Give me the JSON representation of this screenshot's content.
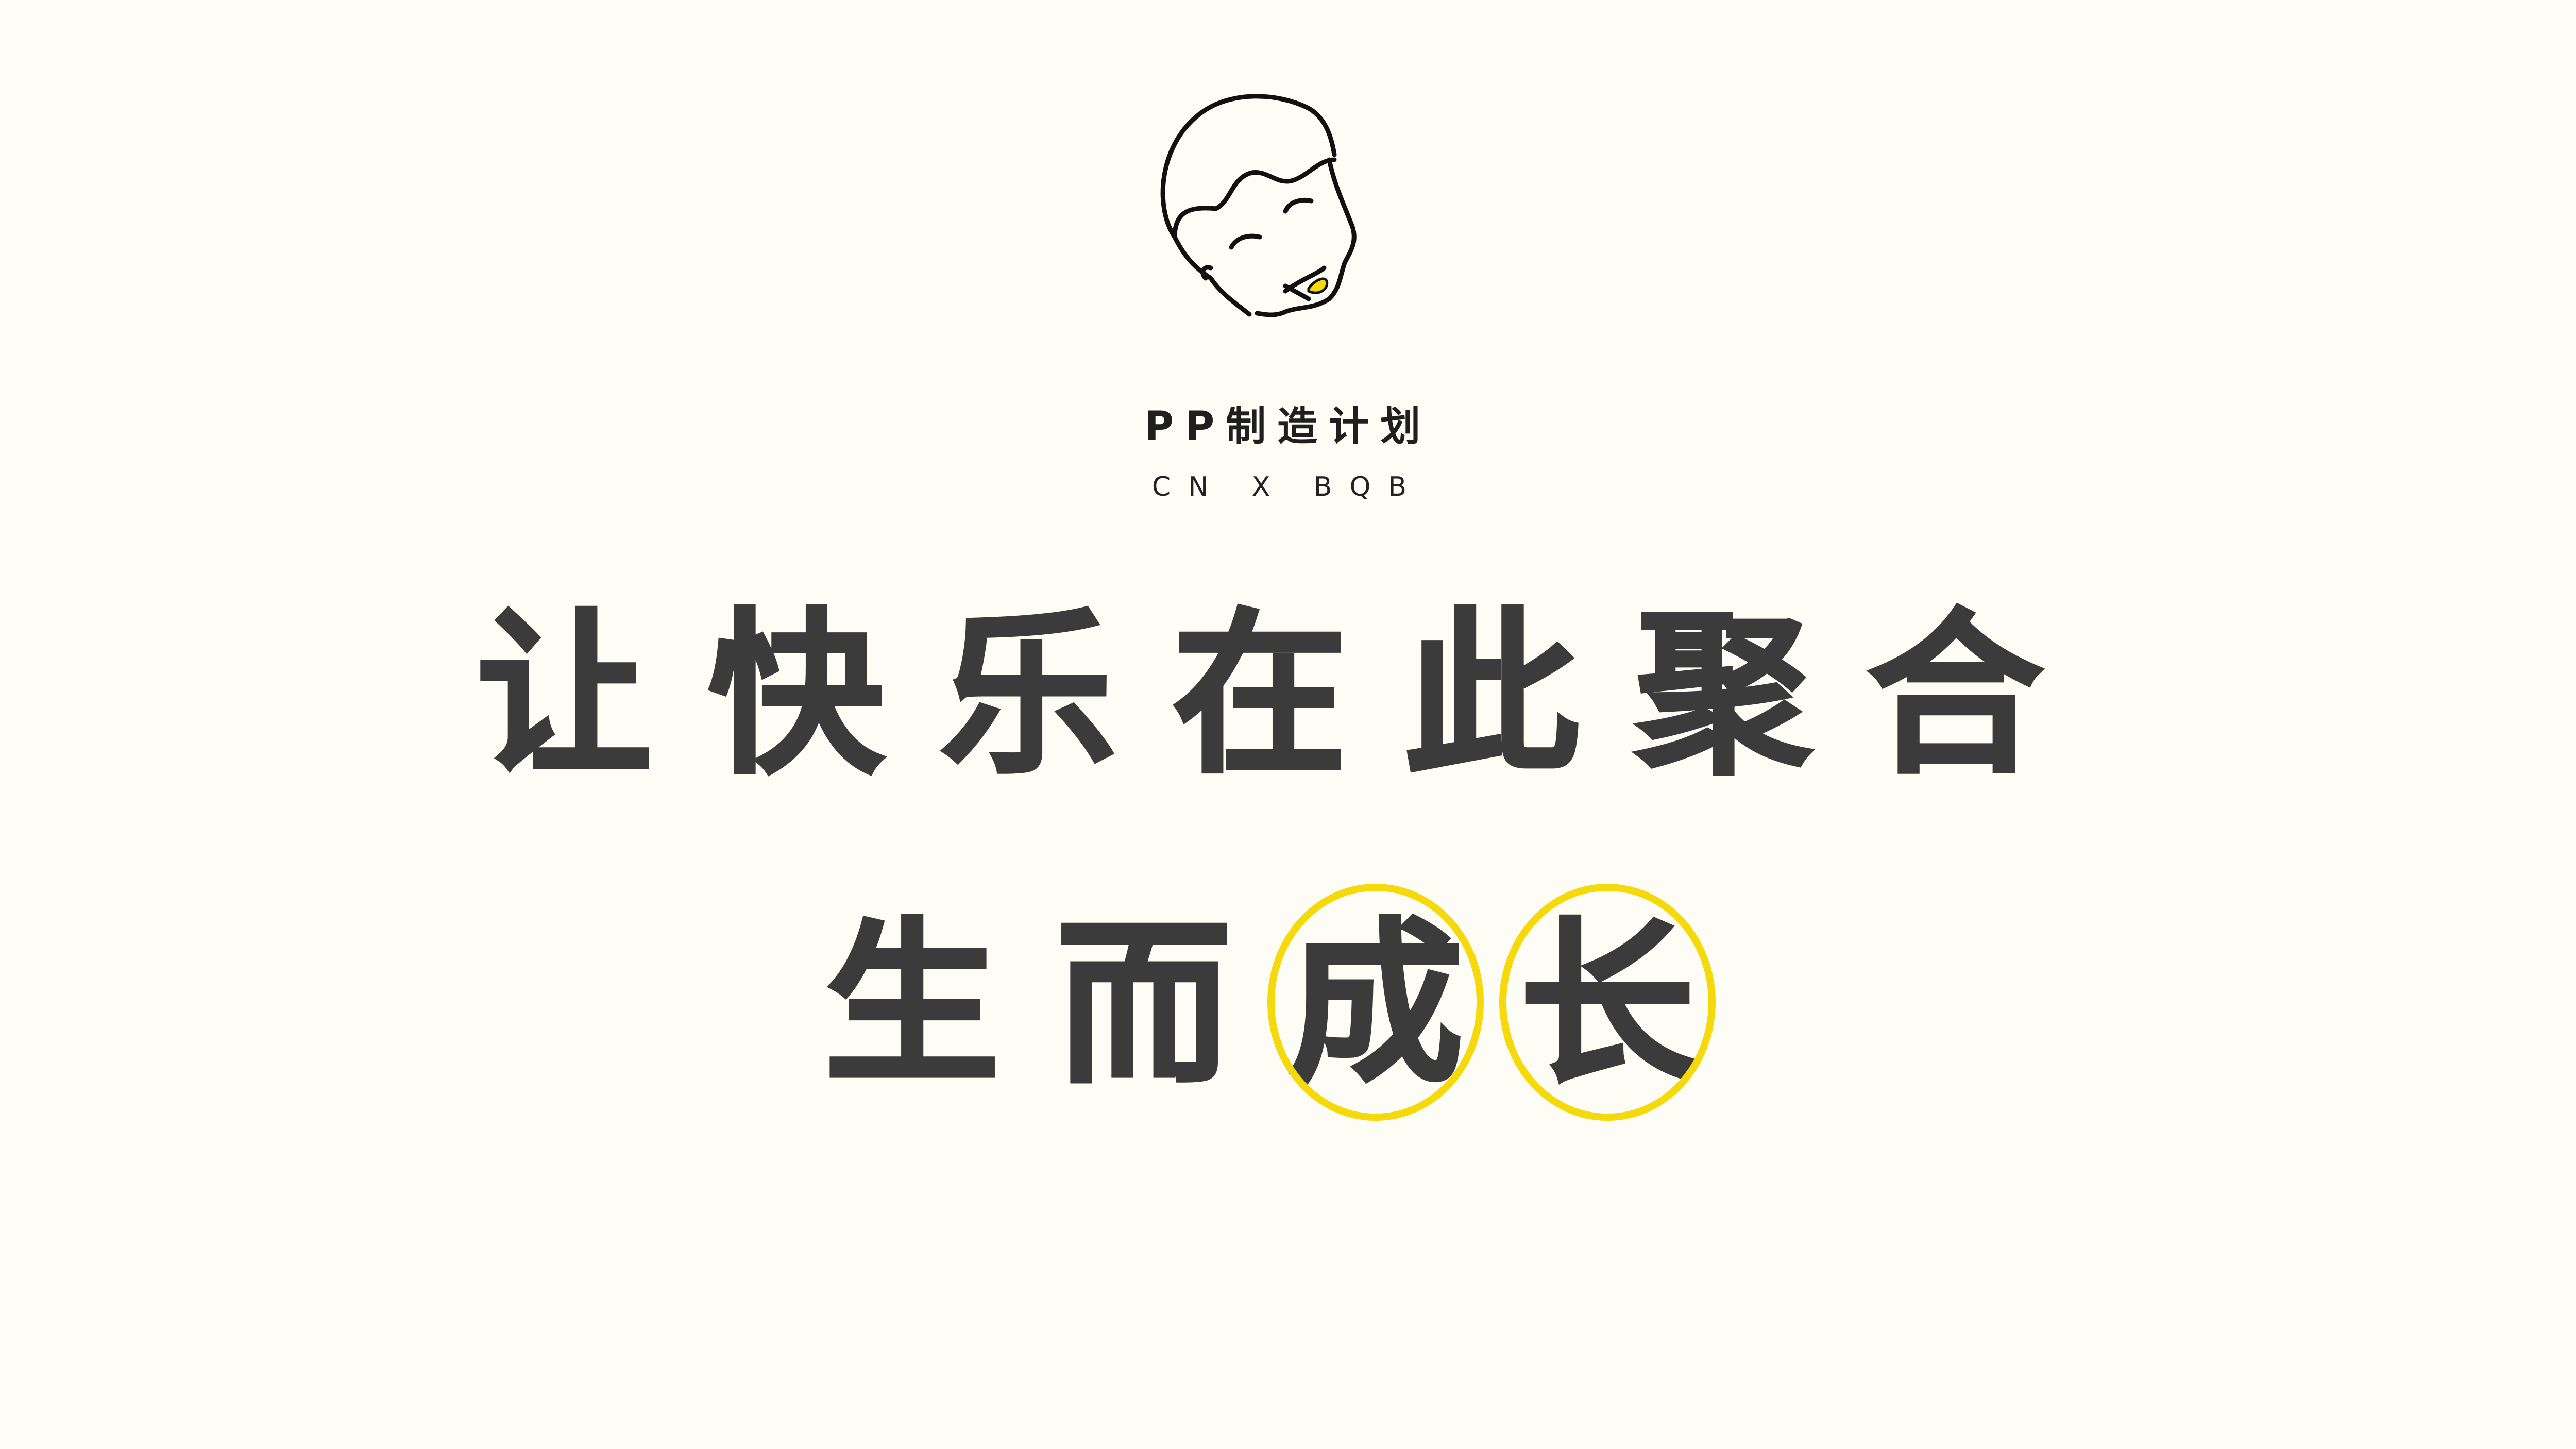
{
  "brand": {
    "name": "PP制造计划",
    "tagline": "CN X BQB",
    "accent_color": "#f5d90a",
    "logo_icon": "boy-face-line-drawing"
  },
  "headline": {
    "line1": [
      "让",
      "快",
      "乐",
      "在",
      "此",
      "聚",
      "合"
    ],
    "line2": [
      "生",
      "而",
      "成",
      "长"
    ]
  }
}
